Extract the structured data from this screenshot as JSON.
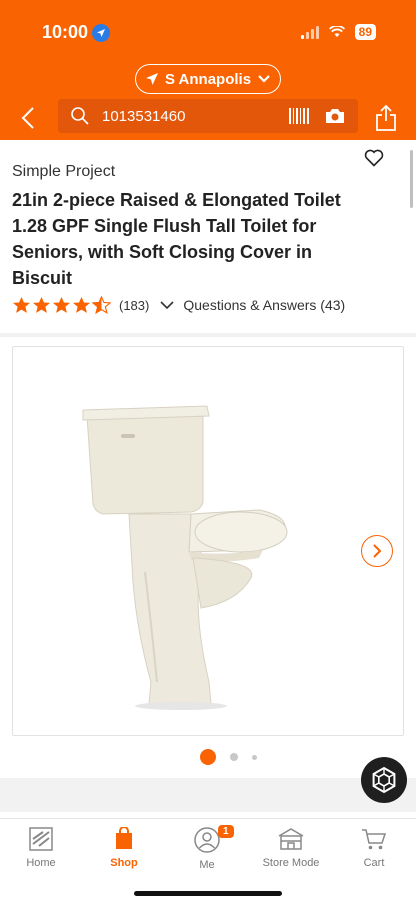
{
  "status_bar": {
    "time": "10:00",
    "battery": "89"
  },
  "header": {
    "store_name": "S Annapolis",
    "search_value": "1013531460"
  },
  "product": {
    "brand": "Simple Project",
    "title": "21in 2-piece Raised & Elongated Toilet 1.28 GPF Single Flush Tall Toilet for Seniors, with Soft Closing Cover in Biscuit",
    "rating": 4.5,
    "review_count": "(183)",
    "qa_label": "Questions & Answers (43)"
  },
  "gallery": {
    "image_count": 3,
    "active_index": 0
  },
  "tab_bar": {
    "tabs": [
      {
        "label": "Home",
        "icon": "home-depot-logo-icon"
      },
      {
        "label": "Shop",
        "icon": "shop-bag-icon",
        "active": true
      },
      {
        "label": "Me",
        "icon": "person-icon",
        "badge": "1"
      },
      {
        "label": "Store Mode",
        "icon": "store-icon"
      },
      {
        "label": "Cart",
        "icon": "cart-icon"
      }
    ]
  },
  "colors": {
    "brand_orange": "#f96302",
    "search_bg": "#e2570a",
    "biscuit": "#ede9dc"
  }
}
